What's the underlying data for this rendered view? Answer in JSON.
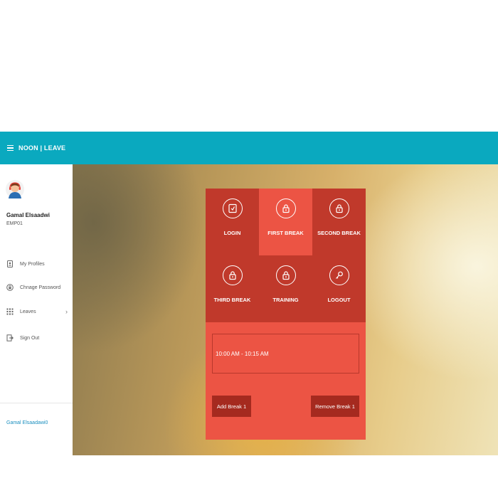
{
  "header": {
    "brand": "NOON | LEAVE",
    "menu_icon": "hamburger-icon",
    "bar_color": "#0aa9bf"
  },
  "sidebar": {
    "user_name": "Gamal Elsaadwi",
    "user_id": "EMP01",
    "items": [
      {
        "label": "My Profiles",
        "icon": "id-card-icon"
      },
      {
        "label": "Chnage Password",
        "icon": "lock-circle-icon"
      },
      {
        "label": "Leaves",
        "icon": "grid-icon",
        "has_submenu": true
      },
      {
        "label": "Sign Out",
        "icon": "sign-out-icon"
      }
    ],
    "footer_name": "Gamal Elsaadawi0"
  },
  "panel": {
    "tiles": [
      {
        "label": "LOGIN",
        "icon": "login-card-icon",
        "active": false
      },
      {
        "label": "FIRST BREAK",
        "icon": "lock-icon",
        "active": true
      },
      {
        "label": "SECOND BREAK",
        "icon": "lock-icon",
        "active": false
      },
      {
        "label": "THIRD BREAK",
        "icon": "lock-icon",
        "active": false
      },
      {
        "label": "TRAINING",
        "icon": "lock-icon",
        "active": false
      },
      {
        "label": "LOGOUT",
        "icon": "key-icon",
        "active": false
      }
    ],
    "time_range": "10:00 AM - 10:15 AM",
    "add_button": "Add Break 1",
    "remove_button": "Remove Break 1",
    "colors": {
      "panel": "#ec5444",
      "tiles_bg": "#c0392b",
      "button": "#a52a1f"
    }
  }
}
